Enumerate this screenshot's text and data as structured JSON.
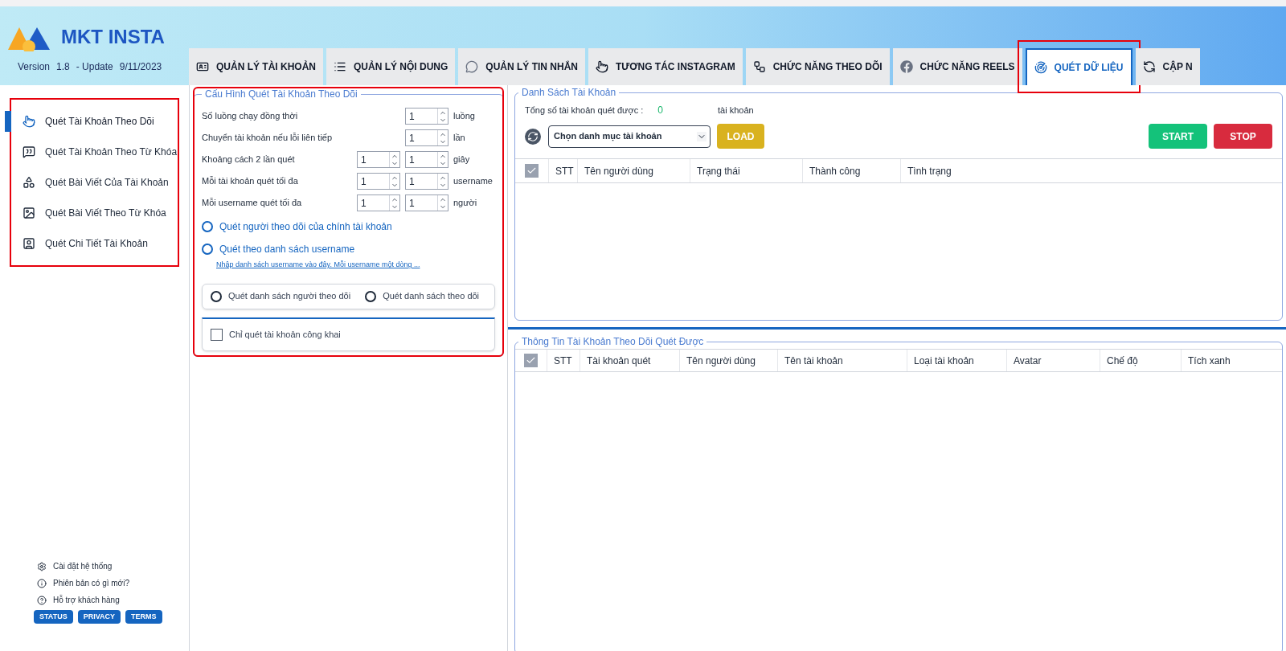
{
  "header": {
    "logo_text": "MKT INSTA",
    "version_label": "Version",
    "version": "1.8",
    "update_label": "- Update",
    "update_date": "9/11/2023"
  },
  "tabs": [
    {
      "label": "QUẢN LÝ TÀI KHOẢN",
      "selected": false
    },
    {
      "label": "QUẢN LÝ NỘI DUNG",
      "selected": false
    },
    {
      "label": "QUẢN LÝ TIN NHẮN",
      "selected": false
    },
    {
      "label": "TƯƠNG TÁC INSTAGRAM",
      "selected": false
    },
    {
      "label": "CHỨC NĂNG THEO DÕI",
      "selected": false
    },
    {
      "label": "CHỨC NĂNG REELS",
      "selected": false
    },
    {
      "label": "QUÉT DỮ LIỆU",
      "selected": true
    },
    {
      "label": "CẬP N",
      "selected": false
    }
  ],
  "sidebar": {
    "items": [
      {
        "label": "Quét Tài Khoản Theo Dõi",
        "selected": true
      },
      {
        "label": "Quét Tài Khoản Theo Từ Khóa",
        "selected": false
      },
      {
        "label": "Quét Bài Viết Của Tài Khoản",
        "selected": false
      },
      {
        "label": "Quét Bài Viết Theo Từ Khóa",
        "selected": false
      },
      {
        "label": "Quét Chi Tiết Tài Khoản",
        "selected": false
      }
    ],
    "footer_links": [
      "Cài đặt hệ thống",
      "Phiên bản có gì mới?",
      "Hỗ trợ khách hàng"
    ],
    "footer_buttons": [
      "STATUS",
      "PRIVACY",
      "TERMS"
    ]
  },
  "config": {
    "title": "Cấu Hình Quét Tài Khoản Theo Dõi",
    "rows": [
      {
        "label": "Số luồng chạy đồng thời",
        "values": [
          "1"
        ],
        "unit": "luồng"
      },
      {
        "label": "Chuyển tài khoản nếu lỗi liên tiếp",
        "values": [
          "1"
        ],
        "unit": "lần"
      },
      {
        "label": "Khoảng cách 2 lần quét",
        "values": [
          "1",
          "1"
        ],
        "unit": "giây"
      },
      {
        "label": "Mỗi tài khoản quét tối đa",
        "values": [
          "1",
          "1"
        ],
        "unit": "username"
      },
      {
        "label": "Mỗi username quét tối đa",
        "values": [
          "1",
          "1"
        ],
        "unit": "người"
      }
    ],
    "radios": [
      {
        "label": "Quét người theo dõi của chính tài khoản",
        "selected": false
      },
      {
        "label": "Quét theo danh sách username",
        "selected": false
      }
    ],
    "list_link": "Nhập danh sách username vào đây. Mỗi username một dòng ...",
    "sub_radios": [
      {
        "label": "Quét danh sách người theo dõi",
        "selected": false
      },
      {
        "label": "Quét danh sách theo dõi",
        "selected": false
      }
    ],
    "public_only": {
      "label": "Chỉ quét tài khoản công khai",
      "checked": false
    }
  },
  "accounts": {
    "title": "Danh Sách Tài Khoản",
    "total_label": "Tổng số tài khoản quét được :",
    "total_value": "0",
    "total_unit": "tài khoản",
    "category": "Chọn danh mục tài khoản",
    "load": "LOAD",
    "start": "START",
    "stop": "STOP",
    "all_checked": true,
    "columns": [
      "STT",
      "Tên người dùng",
      "Trạng thái",
      "Thành công",
      "Tình trạng"
    ]
  },
  "results": {
    "title": "Thông Tin Tài Khoản Theo Dõi Quét Được",
    "all_checked": true,
    "columns": [
      "STT",
      "Tài khoản quét",
      "Tên người dùng",
      "Tên tài khoản",
      "Loại tài khoản",
      "Avatar",
      "Chế độ",
      "Tích xanh"
    ]
  }
}
